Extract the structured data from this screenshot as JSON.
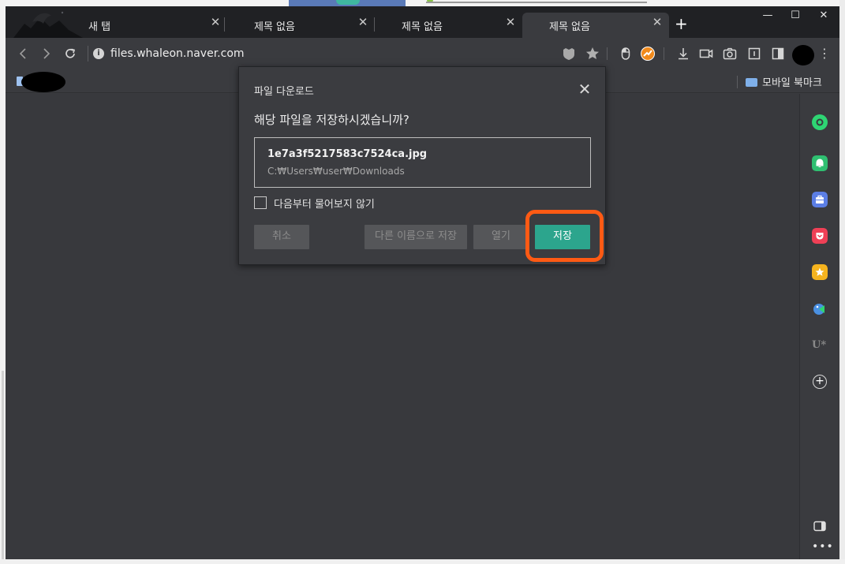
{
  "browser": {
    "tabs": [
      {
        "label": "새 탭",
        "active": false
      },
      {
        "label": "제목 없음",
        "active": false
      },
      {
        "label": "제목 없음",
        "active": false
      },
      {
        "label": "제목 없음",
        "active": true
      }
    ],
    "new_tab_label": "+",
    "window_controls": {
      "minimize": "—",
      "maximize": "☐",
      "close": "✕"
    },
    "toolbar": {
      "back_icon": "chevron-left-icon",
      "forward_icon": "chevron-right-icon",
      "reload_icon": "reload-icon",
      "info_glyph": "i",
      "url": "files.whaleon.naver.com"
    },
    "bookmarks": {
      "mobile_bookmarks_label": "모바일 북마크"
    }
  },
  "dialog": {
    "title": "파일 다운로드",
    "close_glyph": "✕",
    "question": "해당 파일을 저장하시겠습니까?",
    "file_name": "1e7a3f5217583c7524ca.jpg",
    "file_path": "C:₩Users₩user₩Downloads",
    "dont_ask_label": "다음부터 물어보지 않기",
    "dont_ask_checked": false,
    "buttons": {
      "cancel": "취소",
      "save_as": "다른 이름으로 저장",
      "open": "열기",
      "save": "저장"
    }
  },
  "colors": {
    "save_button": "#2ca58d",
    "highlight_outline": "#ff5a14",
    "window_bg": "#3a3b3f"
  }
}
